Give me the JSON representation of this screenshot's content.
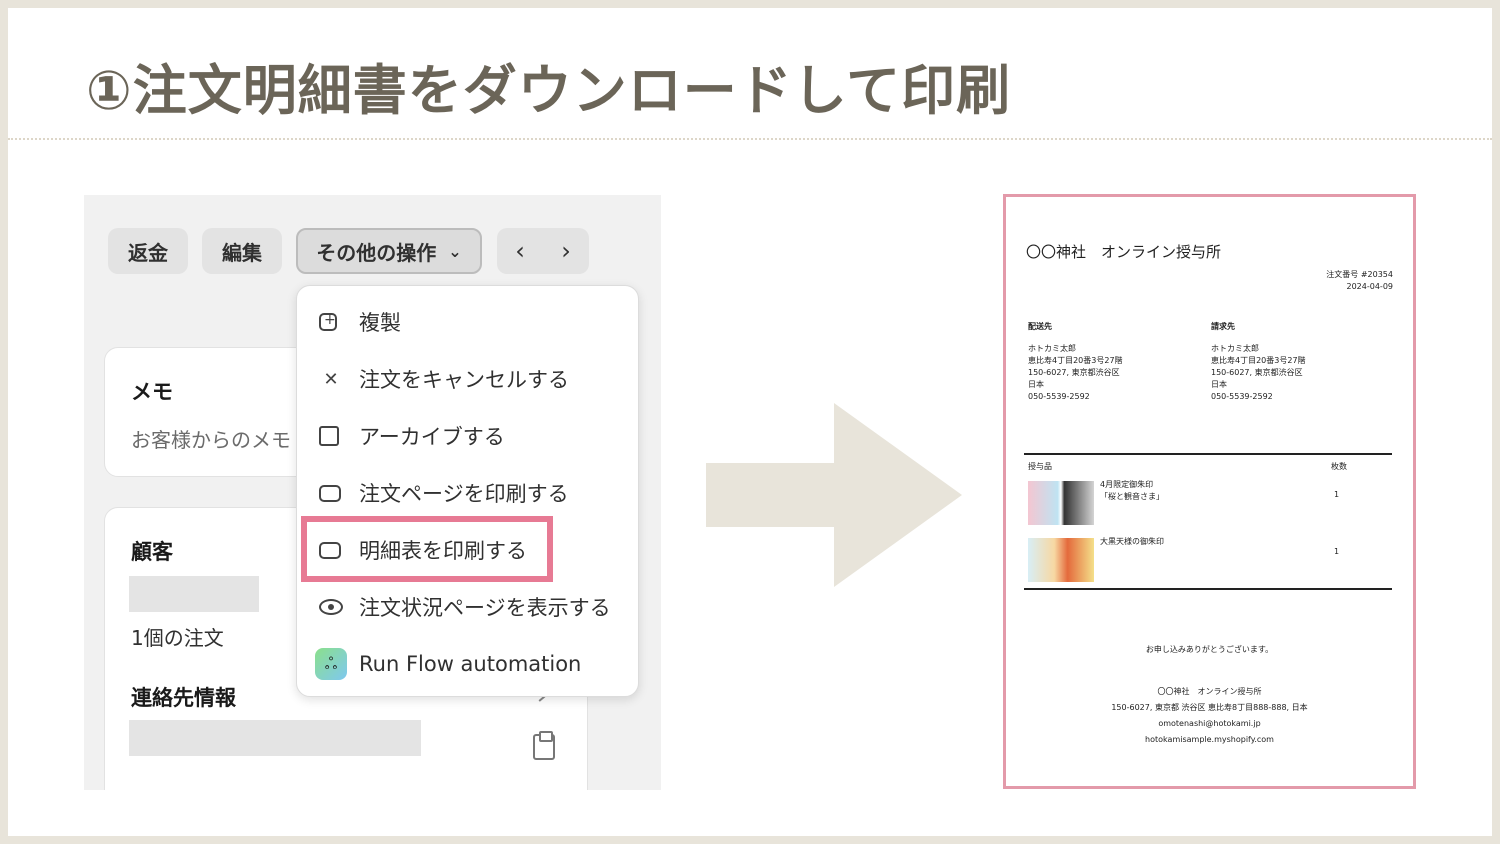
{
  "title": "①注文明細書をダウンロードして印刷",
  "toolbar": {
    "refund": "返金",
    "edit": "編集",
    "more_actions": "その他の操作",
    "chevron": "⌄",
    "prev": "‹",
    "next": "›"
  },
  "menu": {
    "items": [
      {
        "label": "複製",
        "icon": "duplicate-icon"
      },
      {
        "label": "注文をキャンセルする",
        "icon": "x-icon"
      },
      {
        "label": "アーカイブする",
        "icon": "archive-icon"
      },
      {
        "label": "注文ページを印刷する",
        "icon": "printer-icon"
      },
      {
        "label": "明細表を印刷する",
        "icon": "printer-icon"
      },
      {
        "label": "注文状況ページを表示する",
        "icon": "eye-icon"
      },
      {
        "label": "Run Flow automation",
        "icon": "flow-app-icon"
      }
    ],
    "highlight_color": "#e77a94"
  },
  "memo": {
    "heading": "メモ",
    "text": "お客様からのメモ"
  },
  "customer": {
    "heading": "顧客",
    "orders": "1個の注文",
    "contact_heading": "連絡先情報"
  },
  "invoice": {
    "shop_name": "〇〇神社　オンライン授与所",
    "order_number": "注文番号 #20354",
    "order_date": "2024-04-09",
    "ship_to_label": "配送先",
    "bill_to_label": "請求先",
    "ship_to": [
      "ホトカミ太郎",
      "恵比寿4丁目20番3号27階",
      "150-6027, 東京都渋谷区",
      "日本",
      "050-5539-2592"
    ],
    "bill_to": [
      "ホトカミ太郎",
      "恵比寿4丁目20番3号27階",
      "150-6027, 東京都渋谷区",
      "日本",
      "050-5539-2592"
    ],
    "items_label": "授与品",
    "qty_label": "枚数",
    "items": [
      {
        "name_line1": "4月限定御朱印",
        "name_line2": "「桜と観音さま」",
        "qty": "1"
      },
      {
        "name_line1": "大黒天様の御朱印",
        "name_line2": "",
        "qty": "1"
      }
    ],
    "thanks": "お申し込みありがとうございます。",
    "footer": [
      "〇〇神社　オンライン授与所",
      "150-6027, 東京都 渋谷区 恵比寿8丁目888-888, 日本",
      "omotenashi@hotokami.jp",
      "hotokamisample.myshopify.com"
    ],
    "border_color": "#e39aaa"
  },
  "colors": {
    "title": "#6b6558",
    "arrow": "#e8e4da",
    "background": "#e8e4da"
  }
}
